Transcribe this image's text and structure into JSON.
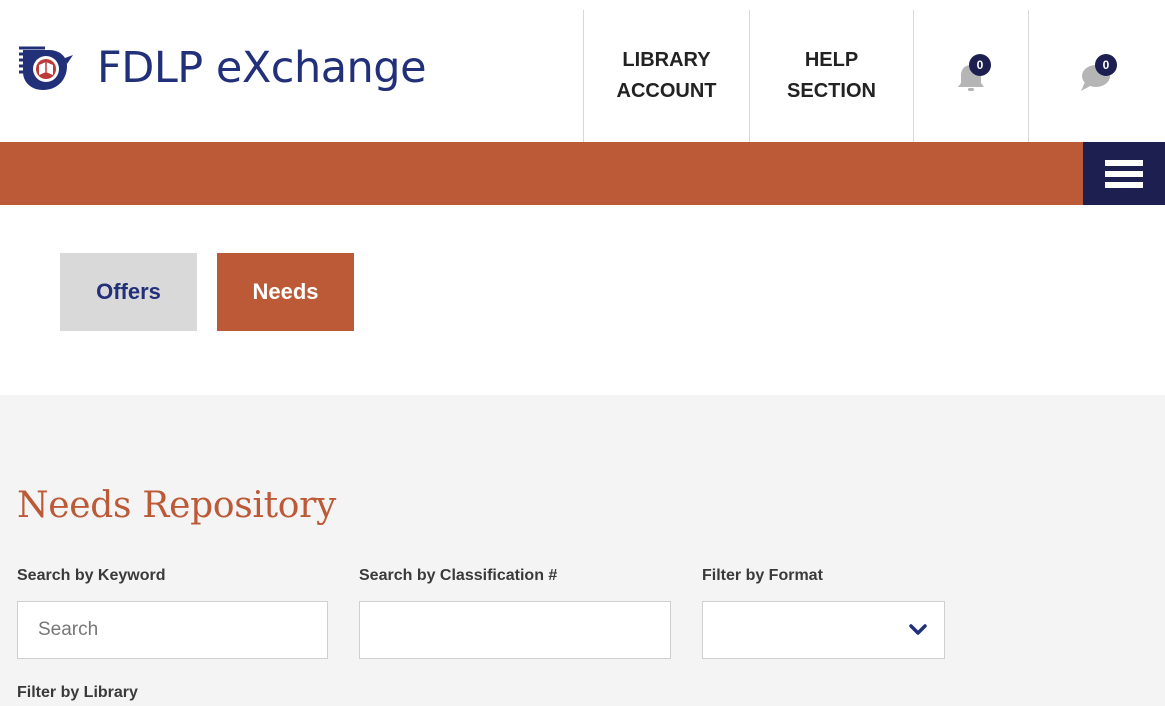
{
  "header": {
    "brand": "FDLP eXchange",
    "nav": [
      {
        "line1": "LIBRARY",
        "line2": "ACCOUNT"
      },
      {
        "line1": "HELP",
        "line2": "SECTION"
      }
    ],
    "notifications": {
      "icon": "bell-icon",
      "count": "0"
    },
    "messages": {
      "icon": "chat-icon",
      "count": "0"
    },
    "menu_icon": "hamburger-menu-icon"
  },
  "tabs": [
    {
      "label": "Offers",
      "active": false
    },
    {
      "label": "Needs",
      "active": true
    }
  ],
  "main": {
    "title": "Needs Repository",
    "filters": {
      "keyword_label": "Search by Keyword",
      "keyword_placeholder": "Search",
      "classification_label": "Search by Classification #",
      "format_label": "Filter by Format",
      "library_label": "Filter by Library"
    }
  },
  "colors": {
    "brand_blue": "#22307a",
    "accent_orange": "#bc5a38",
    "navy": "#1c1f4f",
    "panel_gray": "#f4f4f4"
  }
}
